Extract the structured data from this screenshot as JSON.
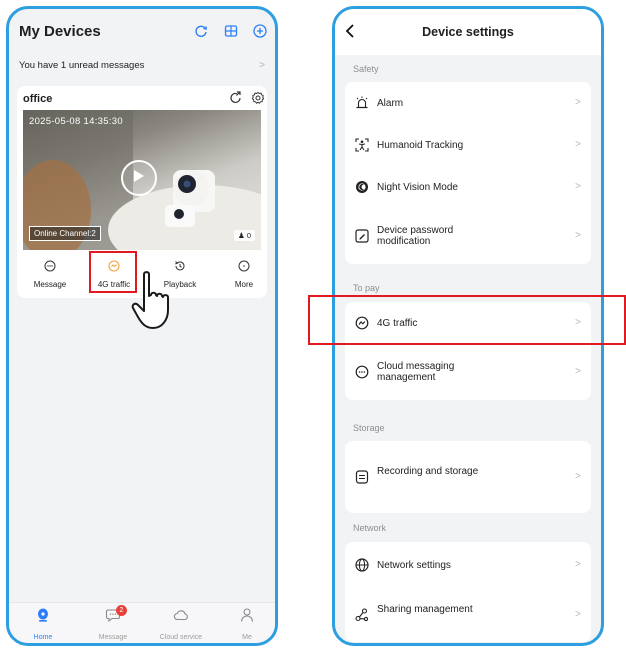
{
  "left": {
    "title": "My Devices",
    "unread_banner": "You have 1 unread messages",
    "device": {
      "name": "office",
      "timestamp": "2025-05-08 14:35:30",
      "channel_status": "Online Channel:2",
      "viewer_count": "0"
    },
    "actions": [
      {
        "label": "Message"
      },
      {
        "label": "4G traffic"
      },
      {
        "label": "Playback"
      },
      {
        "label": "More"
      }
    ],
    "tabs": [
      {
        "label": "Home"
      },
      {
        "label": "Message",
        "badge": "2"
      },
      {
        "label": "Cloud service"
      },
      {
        "label": "Me"
      }
    ]
  },
  "right": {
    "title": "Device settings",
    "sections": [
      {
        "label": "Safety",
        "items": [
          "Alarm",
          "Humanoid Tracking",
          "Night Vision Mode",
          "Device password modification"
        ]
      },
      {
        "label": "To pay",
        "items": [
          "4G traffic",
          "Cloud messaging management"
        ]
      },
      {
        "label": "Storage",
        "items": [
          "Recording and storage"
        ]
      },
      {
        "label": "Network",
        "items": [
          "Network settings",
          "Sharing management"
        ]
      }
    ]
  },
  "colors": {
    "phone_border": "#2d9ee0",
    "highlight": "#e11a22",
    "accent": "#2d7ff9",
    "traffic_icon": "#f2a33a",
    "badge": "#e8413a"
  }
}
